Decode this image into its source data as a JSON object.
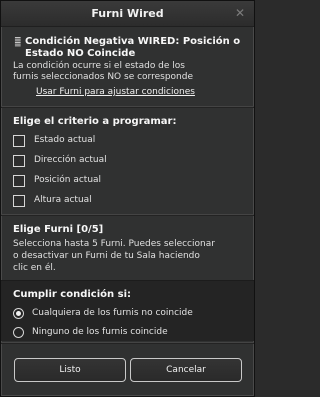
{
  "window": {
    "title": "Furni Wired"
  },
  "condition": {
    "heading": "Condición Negativa WIRED: Posición o Estado NO Coincide",
    "line1": "La condición ocurre si el estado de los",
    "line2": "furnis seleccionados NO se corresponde",
    "link": "Usar Furni para ajustar condiciones"
  },
  "criteria": {
    "heading": "Elige el criterio a programar:",
    "items": [
      {
        "label": "Estado actual",
        "checked": false
      },
      {
        "label": "Dirección actual",
        "checked": false
      },
      {
        "label": "Posición actual",
        "checked": false
      },
      {
        "label": "Altura actual",
        "checked": false
      }
    ]
  },
  "furni": {
    "heading": "Elige Furni [0/5]",
    "line1": "Selecciona hasta 5 Furni. Puedes seleccionar",
    "line2": "o desactivar un Furni de tu Sala haciendo",
    "line3": "clic en él."
  },
  "fulfill": {
    "heading": "Cumplir condición si:",
    "options": [
      {
        "label": "Cualquiera de los furnis no coincide",
        "selected": true
      },
      {
        "label": "Ninguno de los furnis coincide",
        "selected": false
      }
    ]
  },
  "buttons": {
    "ok": "Listo",
    "cancel": "Cancelar"
  },
  "icons": {
    "close": "close-icon",
    "condition": "condition-icon"
  }
}
